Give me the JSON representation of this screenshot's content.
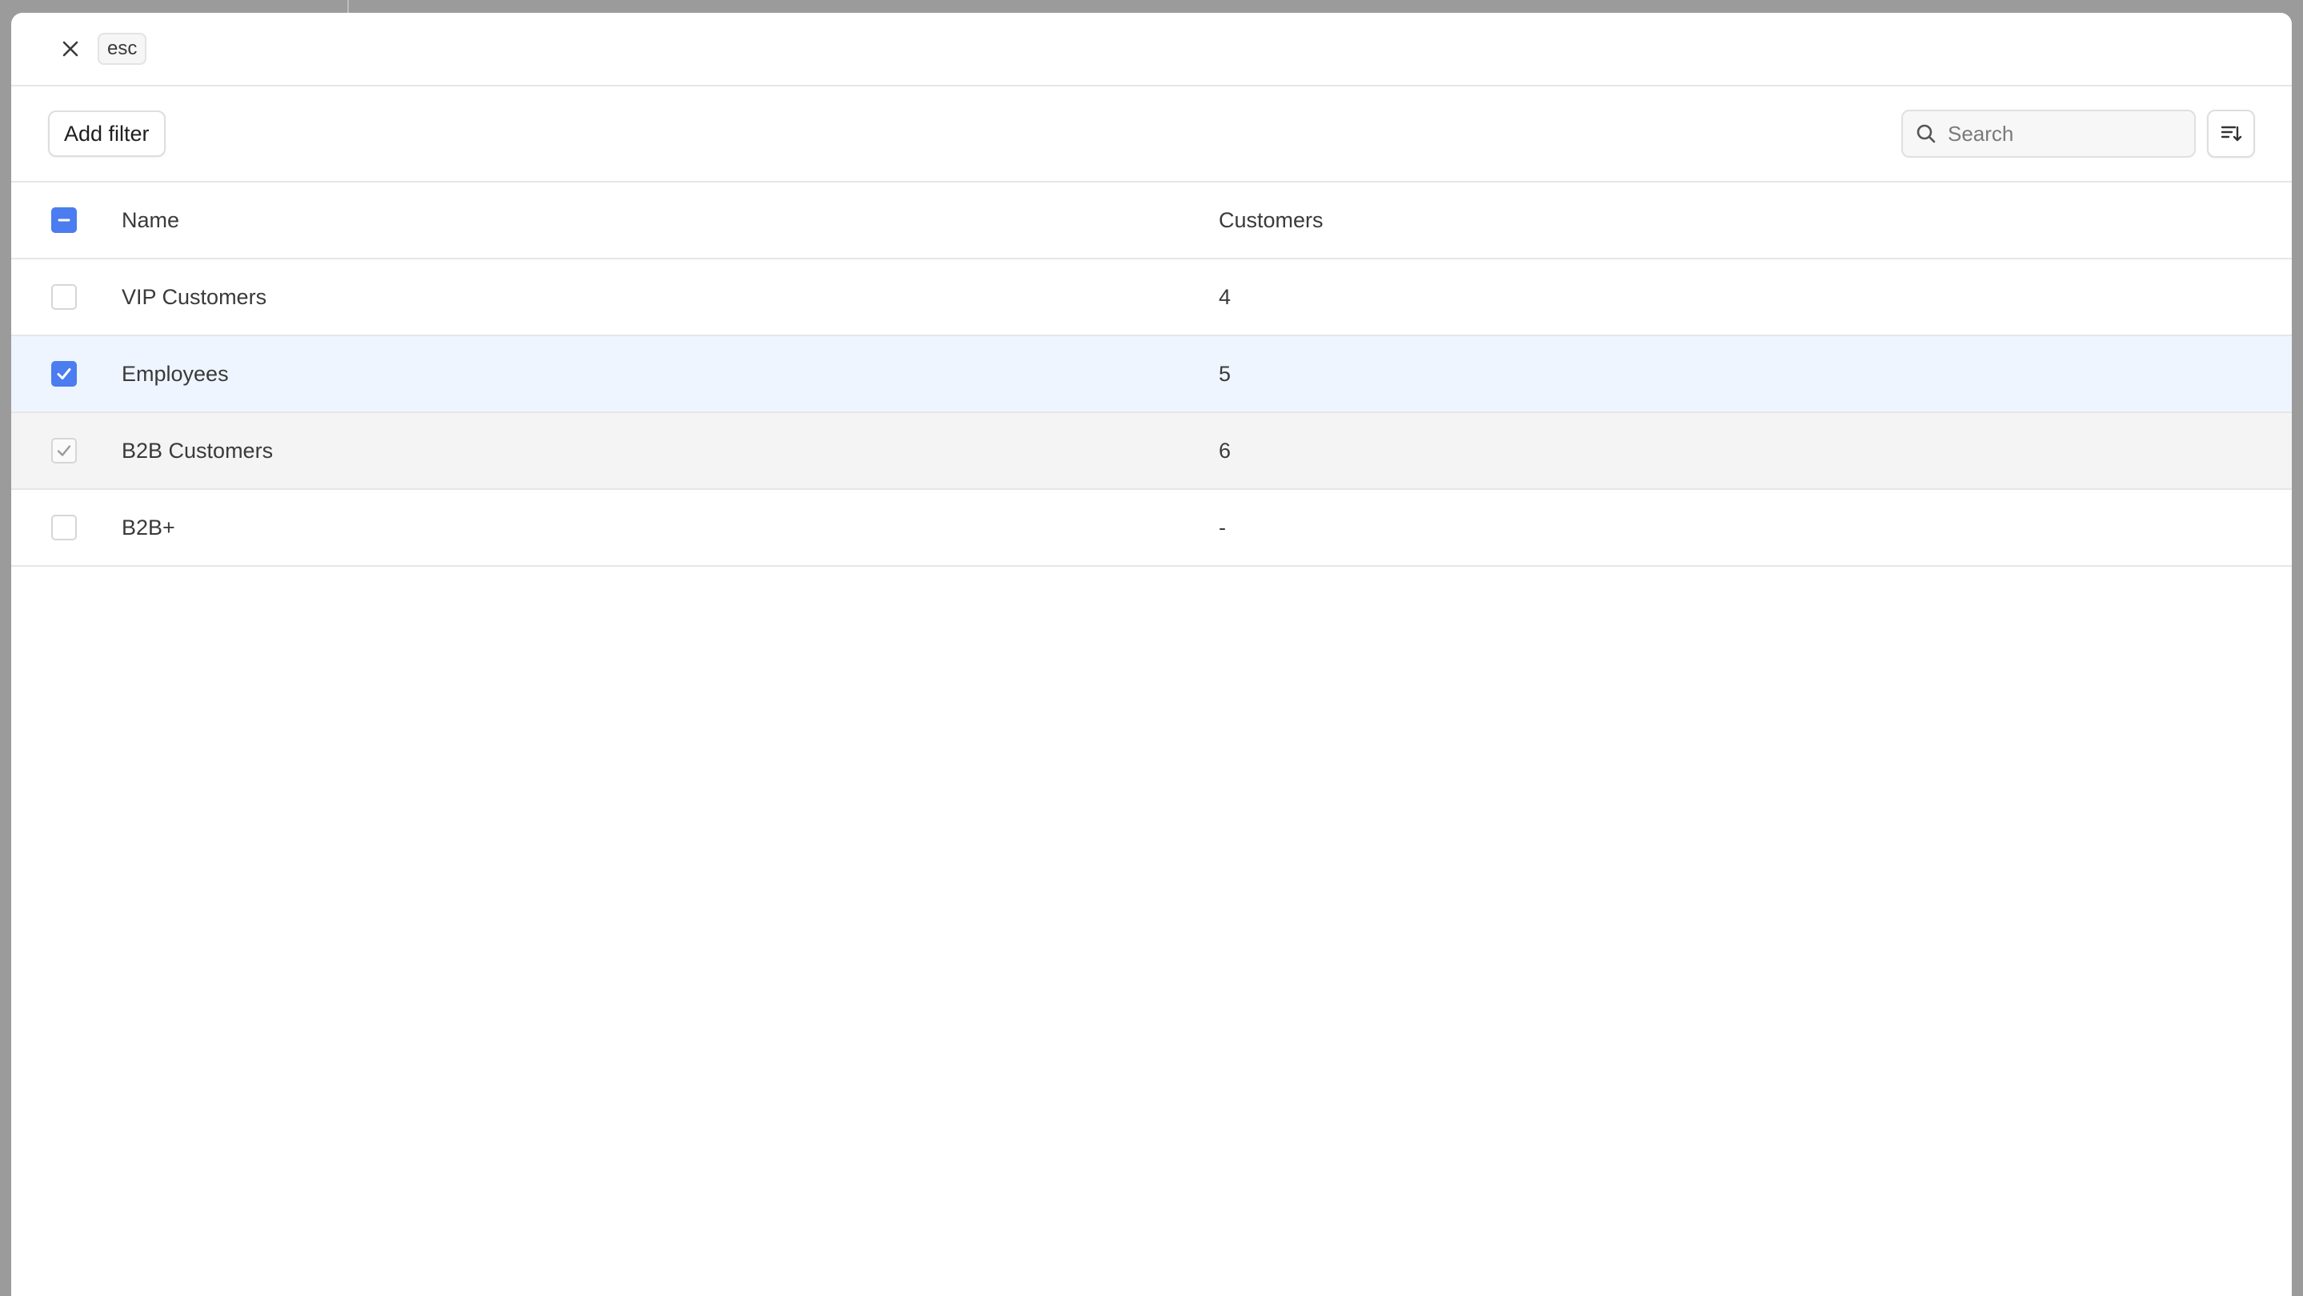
{
  "header": {
    "close_icon": "close-icon",
    "esc_label": "esc"
  },
  "toolbar": {
    "add_filter_label": "Add filter",
    "search_placeholder": "Search",
    "search_icon": "search-icon",
    "sort_icon": "sort-icon"
  },
  "table": {
    "columns": [
      "Name",
      "Customers"
    ],
    "header_checkbox_state": "indeterminate",
    "rows": [
      {
        "name": "VIP Customers",
        "customers": "4",
        "checked": false
      },
      {
        "name": "Employees",
        "customers": "5",
        "checked": true
      },
      {
        "name": "B2B Customers",
        "customers": "6",
        "checked": false
      },
      {
        "name": "B2B+",
        "customers": "-",
        "checked": false
      }
    ]
  },
  "colors": {
    "accent": "#4b7cf0",
    "selected_row": "#eef5fe",
    "hover_row": "#f4f4f4",
    "backdrop": "#9b9b9b"
  }
}
